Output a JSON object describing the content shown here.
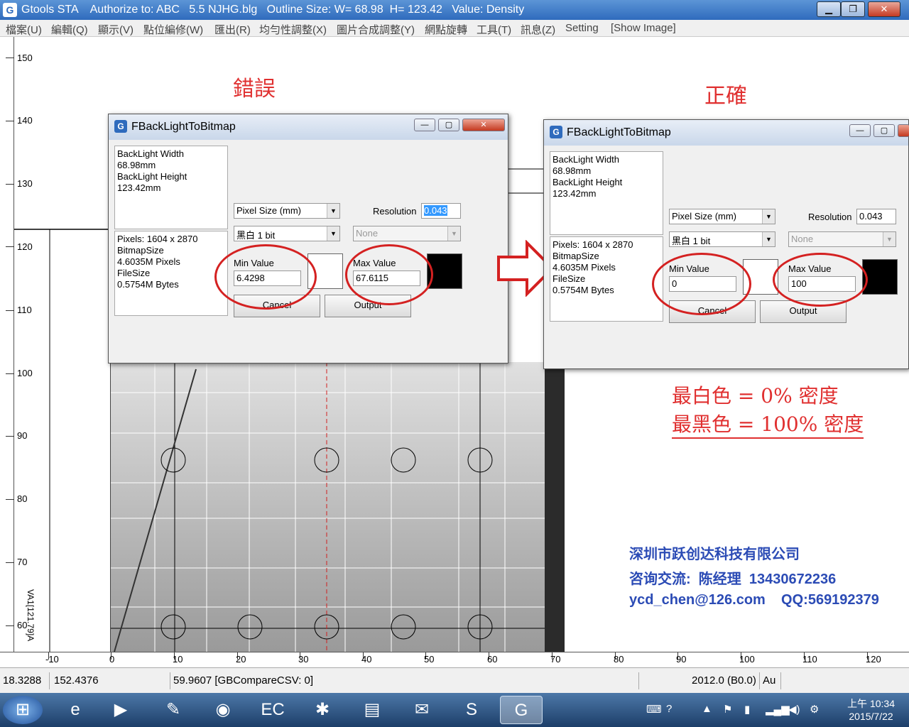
{
  "window": {
    "title": "Gtools STA    Authorize to: ABC   5.5 NJHG.blg   Outline Size: W= 68.98  H= 123.42   Value: Density",
    "controls": {
      "minimize": "▁",
      "maximize": "❐",
      "close": "✕"
    }
  },
  "menu": [
    "檔案(U)",
    "編輯(Q)",
    "顯示(V)",
    "點位編修(W)",
    "匯出(R)",
    "均勻性調整(X)",
    "圖片合成調整(Y)",
    "網點旋轉",
    "工具(T)",
    "訊息(Z)",
    "Setting",
    "[Show Image]"
  ],
  "ruler": {
    "left": [
      "150",
      "140",
      "130",
      "120",
      "110",
      "100",
      "90",
      "80",
      "70",
      "60"
    ],
    "bottom": [
      "-10",
      "0",
      "10",
      "20",
      "30",
      "40",
      "50",
      "60",
      "70",
      "80",
      "90",
      "100",
      "110",
      "120"
    ]
  },
  "canvas_label": "VA1[121.79]A",
  "annotations": {
    "wrong": "錯誤",
    "correct": "正確",
    "rule_white": "最白色  =  0%  密度",
    "rule_black": "最黑色  =  100%  密度"
  },
  "dialog_wrong": {
    "title": "FBackLightToBitmap",
    "info1": [
      "BackLight Width",
      "68.98mm",
      "BackLight Height",
      "123.42mm"
    ],
    "info2": [
      "Pixels: 1604 x 2870",
      "BitmapSize",
      "4.6035M Pixels",
      "FileSize",
      "0.5754M Bytes"
    ],
    "pixel_size": "Pixel Size (mm)",
    "resolution_label": "Resolution",
    "resolution_value": "0.043",
    "mode": "黑白 1 bit",
    "none": "None",
    "min_label": "Min Value",
    "min_value": "6.4298",
    "max_label": "Max Value",
    "max_value": "67.6115",
    "cancel": "Cancel",
    "output": "Output"
  },
  "dialog_correct": {
    "title": "FBackLightToBitmap",
    "info1": [
      "BackLight Width",
      "68.98mm",
      "BackLight Height",
      "123.42mm"
    ],
    "info2": [
      "Pixels: 1604 x 2870",
      "BitmapSize",
      "4.6035M Pixels",
      "FileSize",
      "0.5754M Bytes"
    ],
    "pixel_size": "Pixel Size (mm)",
    "resolution_label": "Resolution",
    "resolution_value": "0.043",
    "mode": "黑白 1 bit",
    "none": "None",
    "min_label": "Min Value",
    "min_value": "0",
    "max_label": "Max Value",
    "max_value": "100",
    "cancel": "Cancel",
    "output": "Output"
  },
  "contact": {
    "company": "深圳市跃创达科技有限公司",
    "line2": "咨询交流:  陈经理  13430672236",
    "line3": "ycd_chen@126.com    QQ:569192379"
  },
  "statusbar": [
    "18.3288",
    "152.4376",
    "59.9607 [GBCompareCSV: 0]",
    "2012.0 (B0.0)",
    "Au"
  ],
  "taskbar": {
    "start": "⊞",
    "apps": [
      {
        "name": "ie-icon",
        "glyph": "e"
      },
      {
        "name": "media-player-icon",
        "glyph": "▶"
      },
      {
        "name": "notes-icon",
        "glyph": "✎"
      },
      {
        "name": "chrome-icon",
        "glyph": "◉"
      },
      {
        "name": "ec-icon",
        "glyph": "EC"
      },
      {
        "name": "game-icon",
        "glyph": "✱"
      },
      {
        "name": "folder-icon",
        "glyph": "▤"
      },
      {
        "name": "mail-icon",
        "glyph": "✉"
      },
      {
        "name": "skype-icon",
        "glyph": "S"
      },
      {
        "name": "gtools-icon",
        "glyph": "G"
      }
    ],
    "clock_time": "上午 10:34",
    "clock_date": "2015/7/22"
  },
  "colors": {
    "annotation_red": "#e03030",
    "contact_blue": "#2b4bb5",
    "titlebar": "#2f6bbd"
  }
}
